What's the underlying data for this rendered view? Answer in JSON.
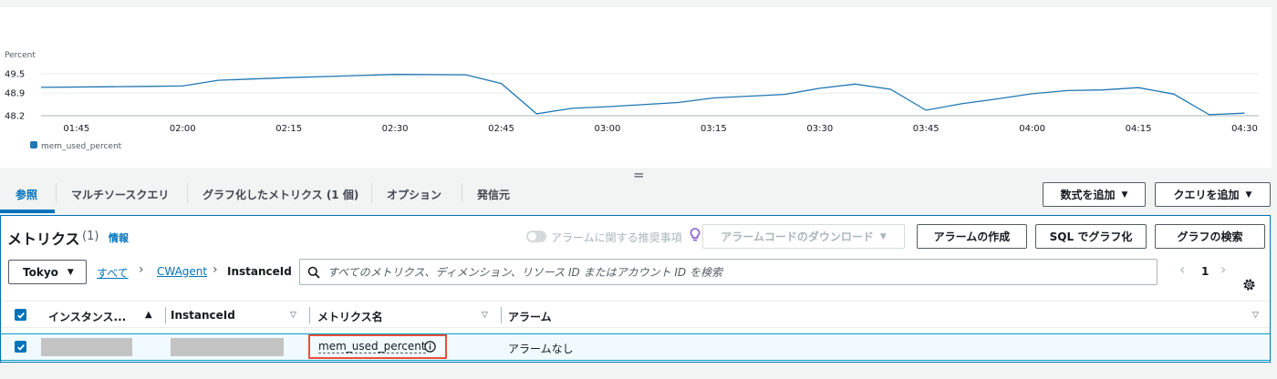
{
  "chart": {
    "unit_label": "Percent",
    "y_ticks": [
      "49.5",
      "48.9",
      "48.2"
    ],
    "x_ticks": [
      "01:45",
      "02:00",
      "02:15",
      "02:30",
      "02:45",
      "03:00",
      "03:15",
      "03:30",
      "03:45",
      "04:00",
      "04:15",
      "04:30"
    ],
    "legend": "mem_used_percent",
    "series_color": "#1f77b4"
  },
  "chart_data": {
    "type": "line",
    "ylabel": "Percent",
    "ylim": [
      48.2,
      49.5
    ],
    "x_range": [
      "01:40",
      "04:32"
    ],
    "series": [
      {
        "name": "mem_used_percent",
        "x": [
          "01:40",
          "01:50",
          "01:55",
          "02:00",
          "02:05",
          "02:15",
          "02:30",
          "02:40",
          "02:45",
          "02:50",
          "02:55",
          "03:00",
          "03:10",
          "03:15",
          "03:25",
          "03:30",
          "03:35",
          "03:40",
          "03:45",
          "03:50",
          "03:55",
          "04:00",
          "04:05",
          "04:10",
          "04:15",
          "04:20",
          "04:25",
          "04:30"
        ],
        "values": [
          49.08,
          49.1,
          49.11,
          49.12,
          49.3,
          49.38,
          49.48,
          49.47,
          49.2,
          48.26,
          48.43,
          48.48,
          48.61,
          48.75,
          48.86,
          49.05,
          49.18,
          49.02,
          48.37,
          48.57,
          48.72,
          48.88,
          48.98,
          49.0,
          49.07,
          48.87,
          48.23,
          48.28
        ]
      }
    ],
    "legend": "bottom-left",
    "grid": true
  },
  "tabs": [
    "参照",
    "マルチソースクエリ",
    "グラフ化したメトリクス (1 個)",
    "オプション",
    "発信元"
  ],
  "active_tab": "参照",
  "buttons": {
    "add_math": "数式を追加",
    "add_query": "クエリを追加",
    "download_alarm": "アラームコードのダウンロード",
    "create_alarm": "アラームの作成",
    "graph_sql": "SQL でグラフ化",
    "graph_search": "グラフの検索"
  },
  "resize_handle_glyph": "=",
  "metrics": {
    "title": "メトリクス",
    "count": "(1)",
    "info": "情報",
    "alarm_toggle_label": "アラームに関する推奨事項",
    "region": "Tokyo",
    "breadcrumb": {
      "all": "すべて",
      "namespace": "CWAgent",
      "dimension": "InstanceId"
    },
    "search_placeholder": "すべてのメトリクス、ディメンション、リソース ID またはアカウント ID を検索",
    "page": "1",
    "columns": [
      "インスタンス...",
      "InstanceId",
      "メトリクス名",
      "アラーム"
    ],
    "rows": [
      {
        "checked": true,
        "metric_name": "mem_used_percent",
        "alarm": "アラームなし"
      }
    ]
  },
  "colors": {
    "accent": "#0073bb",
    "highlight_box": "#e8503a",
    "row_selected": "#f1faff"
  }
}
